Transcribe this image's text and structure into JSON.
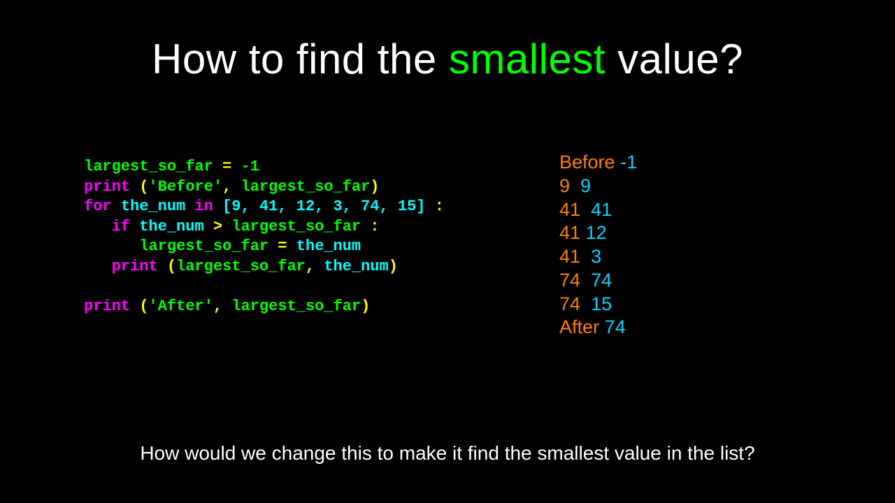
{
  "title": {
    "pre": "How to find the ",
    "highlight": "smallest",
    "post": " value?"
  },
  "code": {
    "l1": {
      "a": "largest_so_far",
      "b": " = ",
      "c": "-1"
    },
    "l2": {
      "a": "print ",
      "b": "(",
      "c": "'Before'",
      "d": ", ",
      "e": "largest_so_far",
      "f": ")"
    },
    "l3": {
      "a": "for ",
      "b": "the_num",
      "c": " in ",
      "d": "[9, 41, 12, 3, 74, 15]",
      "e": " :"
    },
    "l4": {
      "indent": "   ",
      "a": "if ",
      "b": "the_num",
      "c": " > ",
      "d": "largest_so_far",
      "e": " :"
    },
    "l5": {
      "indent": "      ",
      "a": "largest_so_far",
      "b": " = ",
      "c": "the_num"
    },
    "l6": {
      "indent": "   ",
      "a": "print ",
      "b": "(",
      "c": "largest_so_far",
      "d": ", ",
      "e": "the_num",
      "f": ")"
    },
    "l7": "",
    "l8": {
      "a": "print ",
      "b": "(",
      "c": "'After'",
      "d": ", ",
      "e": "largest_so_far",
      "f": ")"
    }
  },
  "output": {
    "before_label": "Before",
    "before_val": "-1",
    "rows": [
      {
        "lsf": "9",
        "sep": "  ",
        "val": "9"
      },
      {
        "lsf": "41",
        "sep": "  ",
        "val": "41"
      },
      {
        "lsf": "41",
        "sep": " ",
        "val": "12"
      },
      {
        "lsf": "41",
        "sep": "  ",
        "val": "3"
      },
      {
        "lsf": "74",
        "sep": "  ",
        "val": "74"
      },
      {
        "lsf": "74",
        "sep": "  ",
        "val": "15"
      }
    ],
    "after_label": "After",
    "after_val": "74"
  },
  "question": "How would we change this to make it find the smallest value in the list?"
}
